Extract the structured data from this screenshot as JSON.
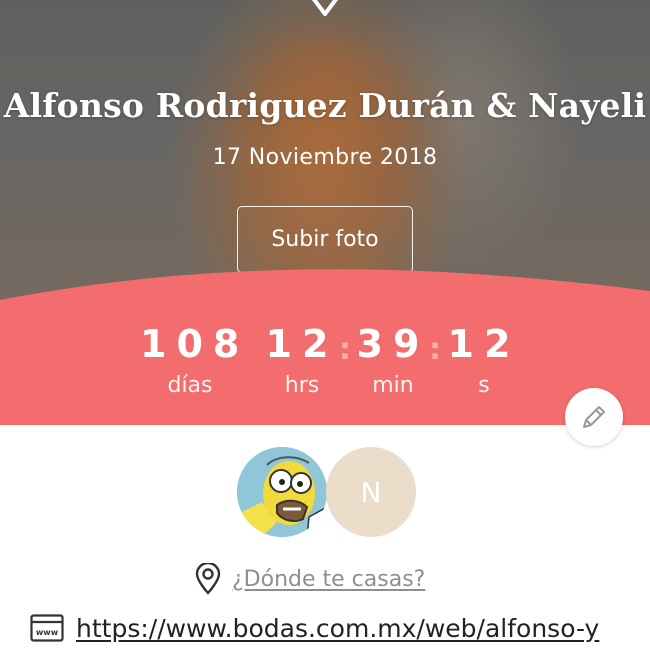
{
  "hero": {
    "title": "Alfonso Rodriguez Durán & Nayeli",
    "date": "17 Noviembre 2018",
    "upload_label": "Subir foto"
  },
  "countdown": {
    "days": "108",
    "days_label": "días",
    "hours": "12",
    "hours_label": "hrs",
    "minutes": "39",
    "minutes_label": "min",
    "seconds": "12",
    "seconds_label": "s",
    "separator": ":"
  },
  "partners": {
    "partner2_initial": "N"
  },
  "location": {
    "prompt": "¿Dónde te casas?",
    "icon": "map-pin-icon"
  },
  "website": {
    "url": "https://www.bodas.com.mx/web/alfonso-y",
    "icon": "www-icon",
    "icon_text": "www"
  },
  "colors": {
    "accent": "#f46d6e",
    "avatar2_bg": "#ecdcca",
    "link_gray": "#8e8e8e"
  }
}
